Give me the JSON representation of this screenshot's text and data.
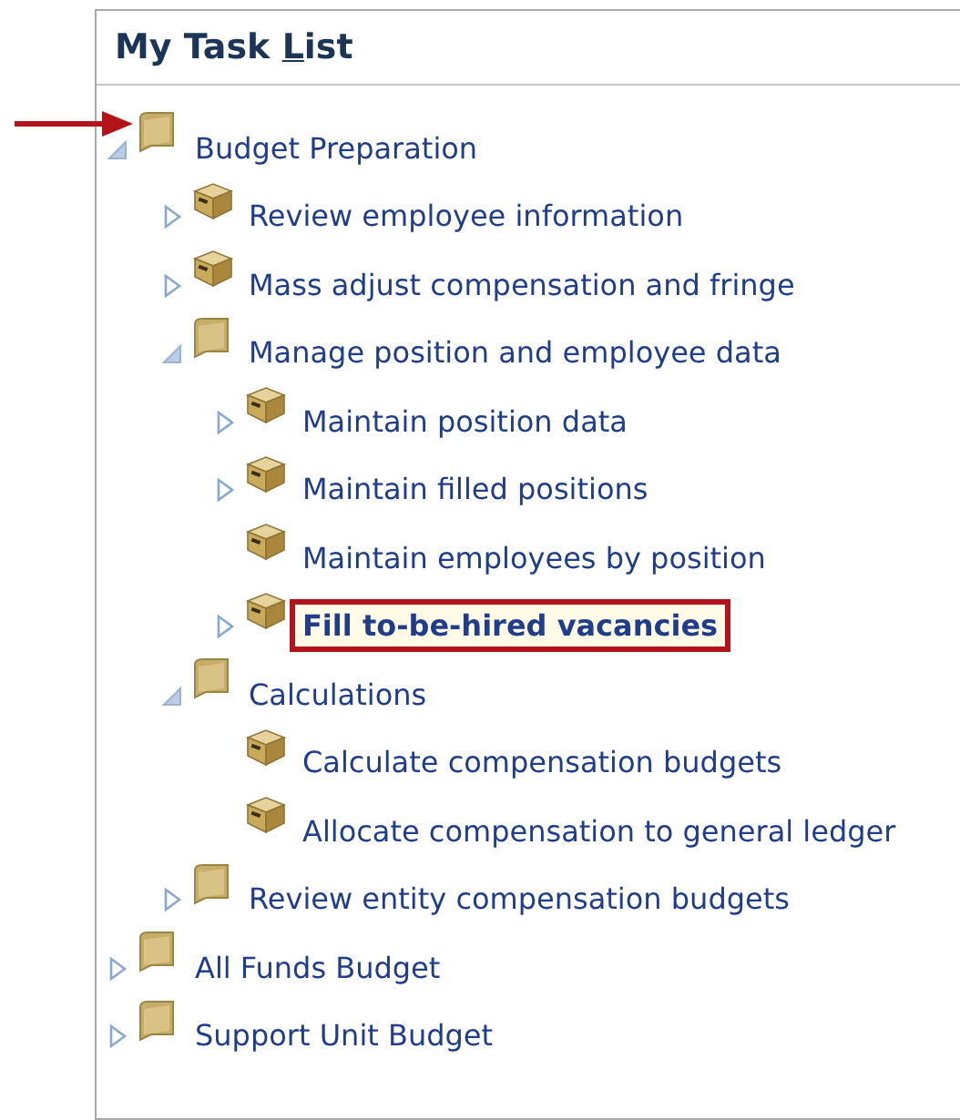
{
  "panel": {
    "title": {
      "before": "My Task ",
      "access_key": "L",
      "after": "ist"
    }
  },
  "tree": [
    {
      "kind": "folder",
      "label": "Budget Preparation",
      "expanded": true,
      "selected": false,
      "children": [
        {
          "kind": "task",
          "label": "Review employee information",
          "expanded": false,
          "selected": false
        },
        {
          "kind": "task",
          "label": "Mass adjust compensation and fringe",
          "expanded": false,
          "selected": false
        },
        {
          "kind": "folder",
          "label": "Manage position and employee data",
          "expanded": true,
          "selected": false,
          "children": [
            {
              "kind": "task",
              "label": "Maintain position data",
              "expanded": false,
              "selected": false
            },
            {
              "kind": "task",
              "label": "Maintain filled positions",
              "expanded": false,
              "selected": false
            },
            {
              "kind": "task",
              "label": "Maintain employees by position",
              "selected": false
            },
            {
              "kind": "task",
              "label": "Fill to-be-hired vacancies",
              "expanded": false,
              "selected": true
            }
          ]
        },
        {
          "kind": "folder",
          "label": "Calculations",
          "expanded": true,
          "selected": false,
          "children": [
            {
              "kind": "task",
              "label": "Calculate compensation budgets",
              "selected": false
            },
            {
              "kind": "task",
              "label": "Allocate compensation to general ledger",
              "selected": false
            }
          ]
        },
        {
          "kind": "folder",
          "label": "Review entity compensation budgets",
          "expanded": false,
          "selected": false
        }
      ]
    },
    {
      "kind": "folder",
      "label": "All Funds Budget",
      "expanded": false,
      "selected": false
    },
    {
      "kind": "folder",
      "label": "Support Unit Budget",
      "expanded": false,
      "selected": false
    }
  ]
}
